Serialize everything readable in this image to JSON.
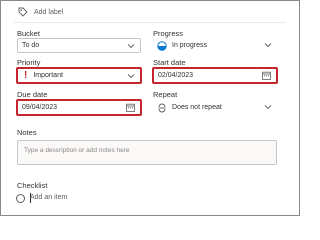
{
  "header": {
    "add_label": "Add label",
    "icon": "tag-icon"
  },
  "bucket": {
    "label": "Bucket",
    "value": "To do"
  },
  "progress": {
    "label": "Progress",
    "value": "In progress",
    "icon": "half-circle-progress-icon"
  },
  "priority": {
    "label": "Priority",
    "value": "Important",
    "icon": "exclamation-icon",
    "accent": "#c4262e"
  },
  "start_date": {
    "label": "Start date",
    "value": "02/04/2023"
  },
  "due_date": {
    "label": "Due date",
    "value": "09/04/2023"
  },
  "repeat": {
    "label": "Repeat",
    "value": "Does not repeat",
    "icon": "repeat-icon"
  },
  "notes": {
    "label": "Notes",
    "placeholder": "Type a description or add notes here"
  },
  "checklist": {
    "label": "Checklist",
    "placeholder": "Add an item"
  },
  "colors": {
    "highlight": "#c4262e",
    "progress_blue": "#0078d4"
  }
}
